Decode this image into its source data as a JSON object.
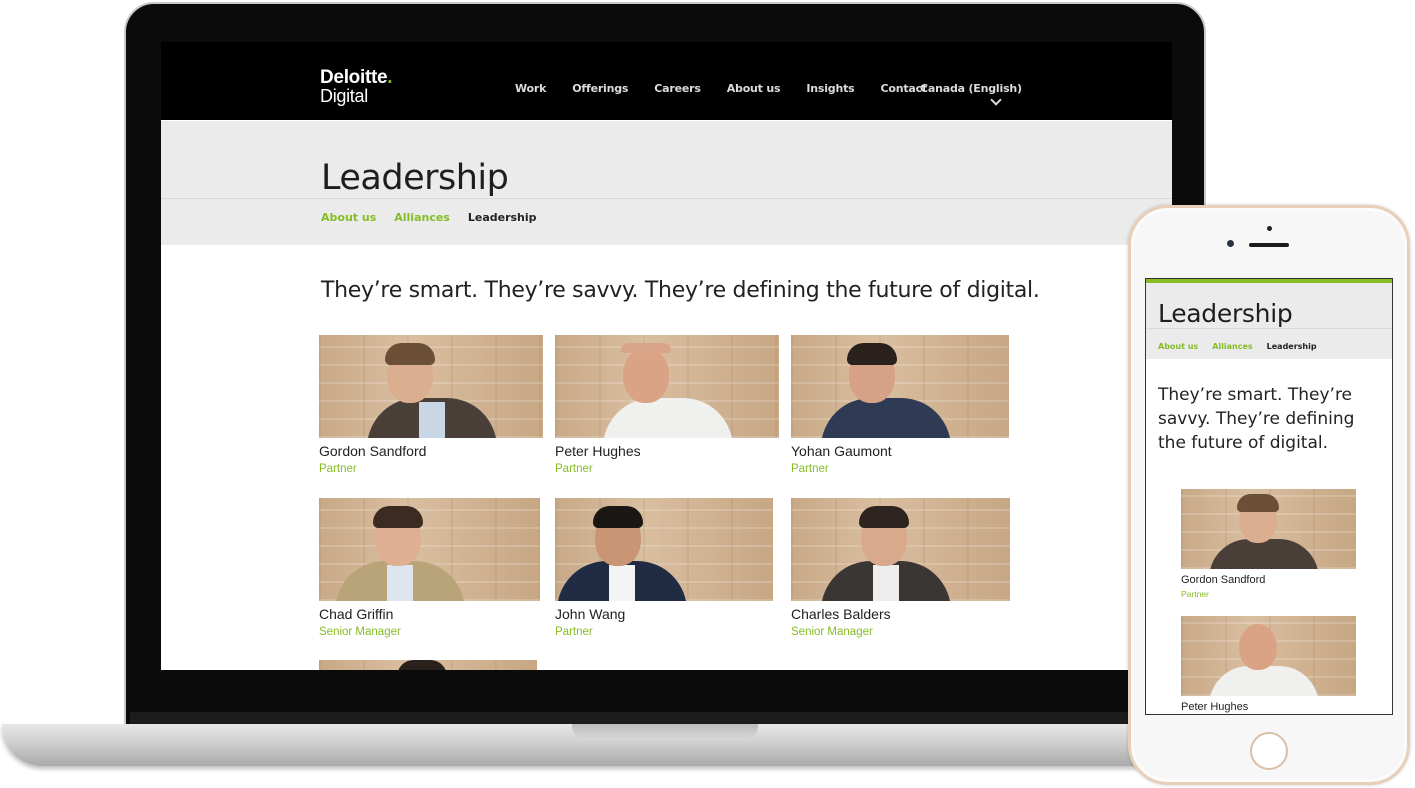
{
  "site": {
    "logo_line1": "Deloitte",
    "logo_dot": ".",
    "logo_line2": "Digital",
    "nav": [
      "Work",
      "Offerings",
      "Careers",
      "About us",
      "Insights",
      "Contact"
    ],
    "region": "Canada (English)"
  },
  "page": {
    "title": "Leadership",
    "breadcrumb": [
      {
        "label": "About us",
        "current": false
      },
      {
        "label": "Alliances",
        "current": false
      },
      {
        "label": "Leadership",
        "current": true
      }
    ],
    "tagline": "They’re smart. They’re savvy. They’re defining the future of digital."
  },
  "people": [
    {
      "name": "Gordon Sandford",
      "role": "Partner"
    },
    {
      "name": "Peter Hughes",
      "role": "Partner"
    },
    {
      "name": "Yohan Gaumont",
      "role": "Partner"
    },
    {
      "name": "Chad Griffin",
      "role": "Senior Manager"
    },
    {
      "name": "John Wang",
      "role": "Partner"
    },
    {
      "name": "Charles Balders",
      "role": "Senior Manager"
    }
  ],
  "phone": {
    "title": "Leadership",
    "tagline": "They’re smart. They’re savvy. They’re defining the future of digital."
  },
  "colors": {
    "accent": "#86bc25",
    "header_bg": "#000000",
    "band_bg": "#ebebeb"
  }
}
